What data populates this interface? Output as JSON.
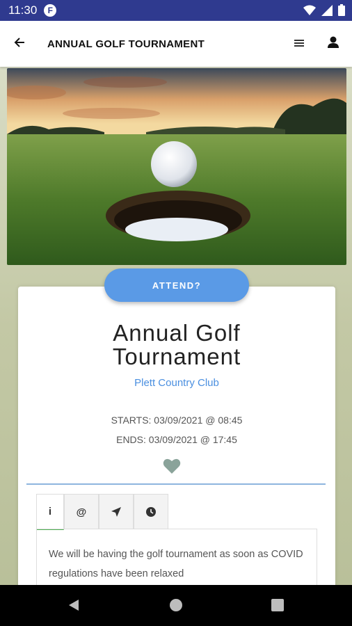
{
  "status_bar": {
    "time": "11:30",
    "app_badge": "F"
  },
  "app_bar": {
    "title": "ANNUAL GOLF TOURNAMENT"
  },
  "event": {
    "attend_label": "ATTEND?",
    "title_line1": "Annual Golf",
    "title_line2": "Tournament",
    "venue": "Plett Country Club",
    "starts": "STARTS: 03/09/2021 @ 08:45",
    "ends": "ENDS: 03/09/2021 @ 17:45"
  },
  "tabs": [
    {
      "icon": "info-icon",
      "glyph": "i"
    },
    {
      "icon": "at-icon",
      "glyph": "@"
    },
    {
      "icon": "navigation-icon",
      "glyph": ""
    },
    {
      "icon": "clock-icon",
      "glyph": ""
    }
  ],
  "tab_content": {
    "text": "We will be having the golf tournament as soon as COVID regulations have been relaxed"
  },
  "colors": {
    "status_bar": "#2f3a8f",
    "accent": "#5a9ae6",
    "venue": "#4a8fe0",
    "heart": "#8aa39a",
    "divider": "#8db5de"
  }
}
